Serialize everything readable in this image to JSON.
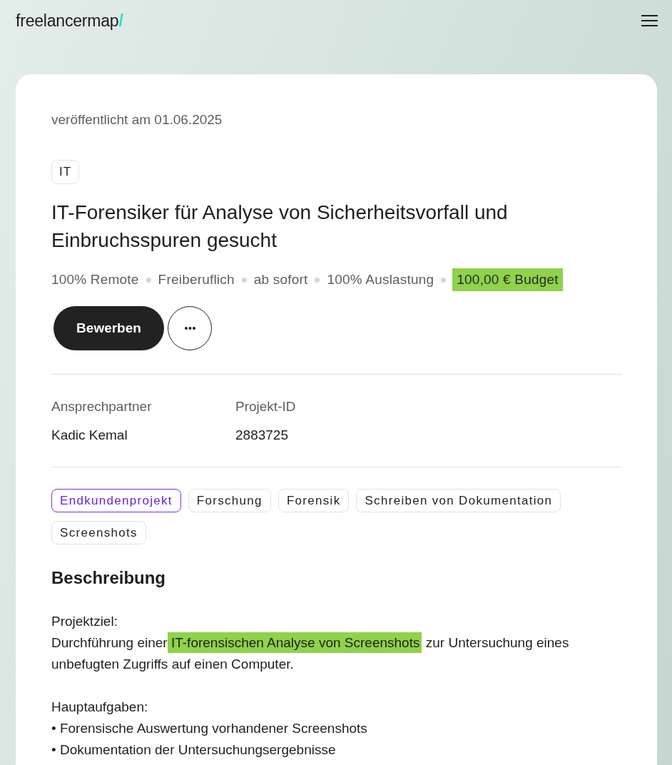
{
  "header": {
    "logo": {
      "text": "freelancermap",
      "mark": "/"
    }
  },
  "project": {
    "published": "veröffentlicht am 01.06.2025",
    "category": "IT",
    "title": "IT-Forensiker für Analyse von Sicherheitsvorfall und Einbruchsspuren gesucht",
    "meta": [
      {
        "text": "100% Remote",
        "highlighted": false
      },
      {
        "text": "Freiberuflich",
        "highlighted": false
      },
      {
        "text": "ab sofort",
        "highlighted": false
      },
      {
        "text": "100% Auslastung",
        "highlighted": false
      },
      {
        "text": "100,00 € Budget",
        "highlighted": true
      }
    ],
    "actions": {
      "apply": "Bewerben"
    },
    "details": [
      {
        "label": "Ansprechpartner",
        "value": "Kadic Kemal"
      },
      {
        "label": "Projekt-ID",
        "value": "2883725"
      }
    ],
    "tags": [
      {
        "text": "Endkundenprojekt",
        "kind": "project-type"
      },
      {
        "text": "Forschung",
        "kind": "skill"
      },
      {
        "text": "Forensik",
        "kind": "skill"
      },
      {
        "text": "Schreiben von Dokumentation",
        "kind": "skill"
      },
      {
        "text": "Screenshots",
        "kind": "skill"
      }
    ]
  },
  "description": {
    "heading": "Beschreibung",
    "sections": [
      {
        "kind": "text",
        "title": "Projektziel:",
        "segments": [
          {
            "text": "Durchführung einer",
            "highlighted": false
          },
          {
            "text": " IT-forensischen Analyse von Screenshots",
            "highlighted": true
          },
          {
            "text": " zur Untersuchung eines unbefugten Zugriffs auf einen Computer.",
            "highlighted": false
          }
        ]
      },
      {
        "kind": "list",
        "title": "Hauptaufgaben:",
        "items": [
          "• Forensische Auswertung vorhandener Screenshots",
          "• Dokumentation der Untersuchungsergebnisse"
        ]
      }
    ]
  }
}
